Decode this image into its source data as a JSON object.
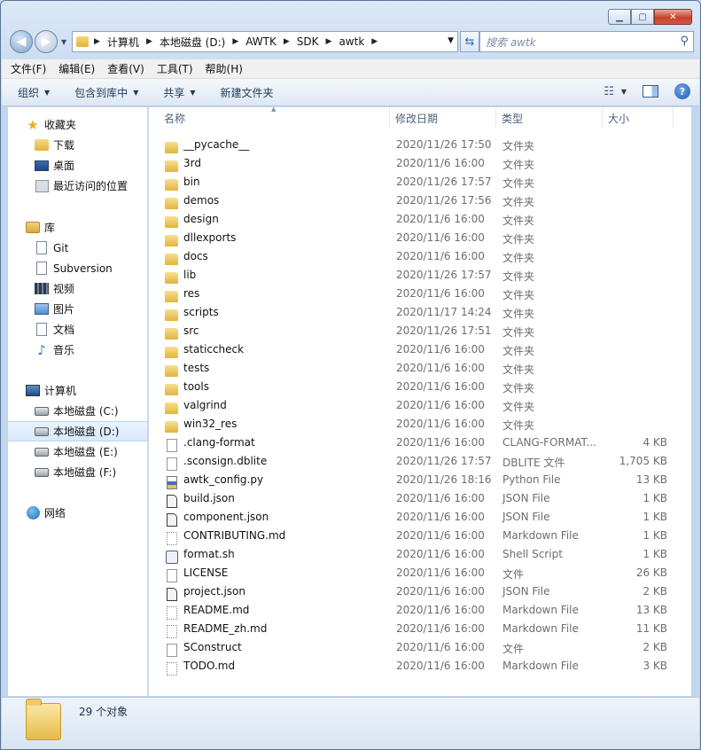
{
  "window": {
    "minimize_icon": "minimize-icon",
    "maximize_icon": "maximize-icon",
    "close_icon": "close-icon"
  },
  "address": {
    "crumbs": [
      "计算机",
      "本地磁盘 (D:)",
      "AWTK",
      "SDK",
      "awtk"
    ]
  },
  "search": {
    "placeholder": "搜索 awtk"
  },
  "menu": [
    "文件(F)",
    "编辑(E)",
    "查看(V)",
    "工具(T)",
    "帮助(H)"
  ],
  "toolbar": {
    "organize": "组织",
    "include_in_library": "包含到库中",
    "share": "共享",
    "new_folder": "新建文件夹"
  },
  "nav": {
    "favorites": {
      "label": "收藏夹",
      "items": [
        "下载",
        "桌面",
        "最近访问的位置"
      ]
    },
    "libraries": {
      "label": "库",
      "items": [
        "Git",
        "Subversion",
        "视频",
        "图片",
        "文档",
        "音乐"
      ]
    },
    "computer": {
      "label": "计算机",
      "items": [
        "本地磁盘 (C:)",
        "本地磁盘 (D:)",
        "本地磁盘 (E:)",
        "本地磁盘 (F:)"
      ],
      "selected": "本地磁盘 (D:)"
    },
    "network": {
      "label": "网络"
    }
  },
  "columns": {
    "name": "名称",
    "date": "修改日期",
    "type": "类型",
    "size": "大小"
  },
  "files": [
    {
      "name": "__pycache__",
      "date": "2020/11/26 17:50",
      "type": "文件夹",
      "size": "",
      "icon": "folder"
    },
    {
      "name": "3rd",
      "date": "2020/11/6 16:00",
      "type": "文件夹",
      "size": "",
      "icon": "folder"
    },
    {
      "name": "bin",
      "date": "2020/11/26 17:57",
      "type": "文件夹",
      "size": "",
      "icon": "folder"
    },
    {
      "name": "demos",
      "date": "2020/11/26 17:56",
      "type": "文件夹",
      "size": "",
      "icon": "folder"
    },
    {
      "name": "design",
      "date": "2020/11/6 16:00",
      "type": "文件夹",
      "size": "",
      "icon": "folder"
    },
    {
      "name": "dllexports",
      "date": "2020/11/6 16:00",
      "type": "文件夹",
      "size": "",
      "icon": "folder"
    },
    {
      "name": "docs",
      "date": "2020/11/6 16:00",
      "type": "文件夹",
      "size": "",
      "icon": "folder"
    },
    {
      "name": "lib",
      "date": "2020/11/26 17:57",
      "type": "文件夹",
      "size": "",
      "icon": "folder"
    },
    {
      "name": "res",
      "date": "2020/11/6 16:00",
      "type": "文件夹",
      "size": "",
      "icon": "folder"
    },
    {
      "name": "scripts",
      "date": "2020/11/17 14:24",
      "type": "文件夹",
      "size": "",
      "icon": "folder"
    },
    {
      "name": "src",
      "date": "2020/11/26 17:51",
      "type": "文件夹",
      "size": "",
      "icon": "folder"
    },
    {
      "name": "staticcheck",
      "date": "2020/11/6 16:00",
      "type": "文件夹",
      "size": "",
      "icon": "folder"
    },
    {
      "name": "tests",
      "date": "2020/11/6 16:00",
      "type": "文件夹",
      "size": "",
      "icon": "folder"
    },
    {
      "name": "tools",
      "date": "2020/11/6 16:00",
      "type": "文件夹",
      "size": "",
      "icon": "folder"
    },
    {
      "name": "valgrind",
      "date": "2020/11/6 16:00",
      "type": "文件夹",
      "size": "",
      "icon": "folder"
    },
    {
      "name": "win32_res",
      "date": "2020/11/6 16:00",
      "type": "文件夹",
      "size": "",
      "icon": "folder"
    },
    {
      "name": ".clang-format",
      "date": "2020/11/6 16:00",
      "type": "CLANG-FORMAT...",
      "size": "4 KB",
      "icon": "file"
    },
    {
      "name": ".sconsign.dblite",
      "date": "2020/11/26 17:57",
      "type": "DBLITE 文件",
      "size": "1,705 KB",
      "icon": "file"
    },
    {
      "name": "awtk_config.py",
      "date": "2020/11/26 18:16",
      "type": "Python File",
      "size": "13 KB",
      "icon": "py"
    },
    {
      "name": "build.json",
      "date": "2020/11/6 16:00",
      "type": "JSON File",
      "size": "1 KB",
      "icon": "json"
    },
    {
      "name": "component.json",
      "date": "2020/11/6 16:00",
      "type": "JSON File",
      "size": "1 KB",
      "icon": "json"
    },
    {
      "name": "CONTRIBUTING.md",
      "date": "2020/11/6 16:00",
      "type": "Markdown File",
      "size": "1 KB",
      "icon": "md"
    },
    {
      "name": "format.sh",
      "date": "2020/11/6 16:00",
      "type": "Shell Script",
      "size": "1 KB",
      "icon": "sh"
    },
    {
      "name": "LICENSE",
      "date": "2020/11/6 16:00",
      "type": "文件",
      "size": "26 KB",
      "icon": "file"
    },
    {
      "name": "project.json",
      "date": "2020/11/6 16:00",
      "type": "JSON File",
      "size": "2 KB",
      "icon": "json"
    },
    {
      "name": "README.md",
      "date": "2020/11/6 16:00",
      "type": "Markdown File",
      "size": "13 KB",
      "icon": "md"
    },
    {
      "name": "README_zh.md",
      "date": "2020/11/6 16:00",
      "type": "Markdown File",
      "size": "11 KB",
      "icon": "md"
    },
    {
      "name": "SConstruct",
      "date": "2020/11/6 16:00",
      "type": "文件",
      "size": "2 KB",
      "icon": "file"
    },
    {
      "name": "TODO.md",
      "date": "2020/11/6 16:00",
      "type": "Markdown File",
      "size": "3 KB",
      "icon": "md"
    }
  ],
  "status": {
    "object_count": "29 个对象"
  }
}
